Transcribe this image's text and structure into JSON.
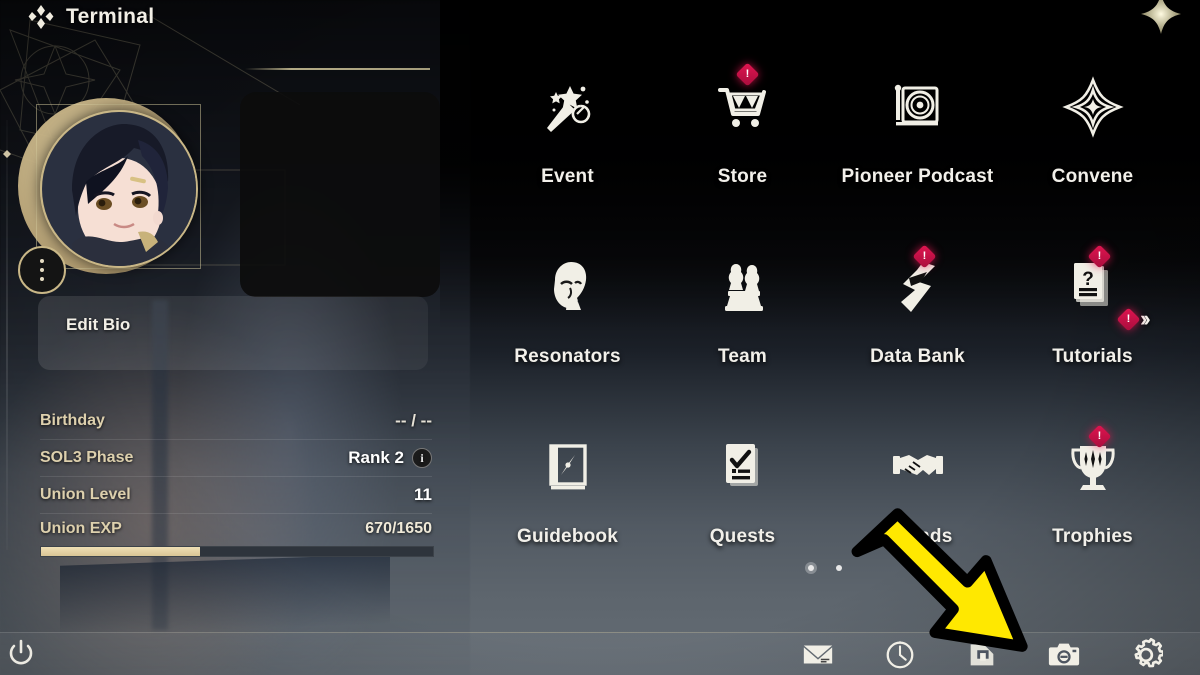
{
  "header": {
    "title": "Terminal",
    "title_icon": "four-diamond-icon",
    "close_icon": "star-close-icon"
  },
  "profile": {
    "avatar_name": "player-avatar",
    "more_button": "avatar-more-dots",
    "edit_bio_label": "Edit Bio",
    "stats": [
      {
        "label": "Birthday",
        "value": "-- / --",
        "info": false
      },
      {
        "label": "SOL3 Phase",
        "value": "Rank 2",
        "info": true
      },
      {
        "label": "Union Level",
        "value": "11",
        "info": false
      }
    ],
    "exp": {
      "label": "Union EXP",
      "value": "670/1650",
      "current": 670,
      "max": 1650,
      "percent": 40.6
    },
    "power_icon": "power-icon"
  },
  "grid": {
    "items": [
      {
        "label": "Event",
        "icon": "party-popper-icon",
        "badge": false
      },
      {
        "label": "Store",
        "icon": "shopping-cart-icon",
        "badge": true
      },
      {
        "label": "Pioneer Podcast",
        "icon": "turntable-icon",
        "badge": false
      },
      {
        "label": "Convene",
        "icon": "star-compass-icon",
        "badge": false
      },
      {
        "label": "Resonators",
        "icon": "character-head-icon",
        "badge": false
      },
      {
        "label": "Team",
        "icon": "chess-pieces-icon",
        "badge": false
      },
      {
        "label": "Data Bank",
        "icon": "data-bank-icon",
        "badge": true
      },
      {
        "label": "Tutorials",
        "icon": "question-card-icon",
        "badge": true
      },
      {
        "label": "Guidebook",
        "icon": "book-compass-icon",
        "badge": false
      },
      {
        "label": "Quests",
        "icon": "checklist-icon",
        "badge": false
      },
      {
        "label": "Friends",
        "icon": "handshake-icon",
        "badge": false
      },
      {
        "label": "Trophies",
        "icon": "trophy-icon",
        "badge": true
      }
    ],
    "more_indicator": {
      "icon": "double-chevron-right-icon",
      "badge": true
    },
    "page_dots": {
      "count": 2,
      "active": 0
    }
  },
  "bottom_bar": {
    "items": [
      {
        "name": "mail",
        "icon": "envelope-icon"
      },
      {
        "name": "clock",
        "icon": "clock-icon"
      },
      {
        "name": "depot",
        "icon": "bag-icon"
      },
      {
        "name": "camera",
        "icon": "camera-icon"
      },
      {
        "name": "settings",
        "icon": "gear-icon"
      }
    ]
  },
  "annotation": {
    "arrow": "yellow-pointer-arrow",
    "points_at": "camera",
    "color": "#FFE800"
  },
  "colors": {
    "accent_gold": "#D6CB9E",
    "badge_red": "#E01550",
    "arrow_yellow": "#FFE800",
    "text_primary": "#F2F0EA"
  }
}
